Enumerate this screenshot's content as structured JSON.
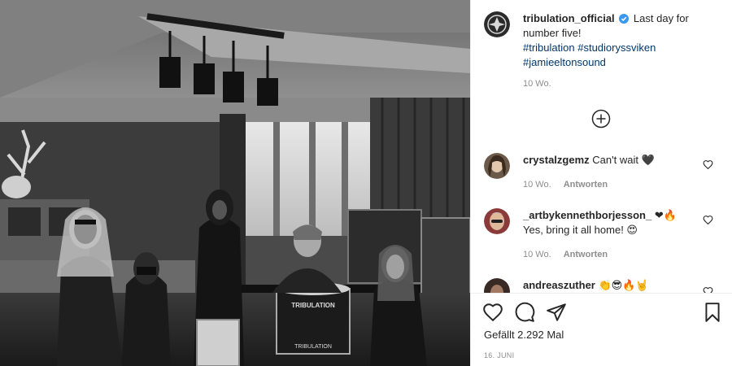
{
  "post": {
    "username": "tribulation_official",
    "caption_text": "Last day for number five!",
    "hashtags": [
      "#tribulation",
      "#studioryssviken",
      "#jamieeltonsound"
    ],
    "caption_time": "10 Wo.",
    "photo_text": {
      "drum_top": "TRIBULATION",
      "drum_bottom": "TRIBULATION"
    }
  },
  "comments": [
    {
      "username": "crystalzgemz",
      "text": "Can't wait 🖤",
      "time": "10 Wo.",
      "reply": "Antworten"
    },
    {
      "username": "_artbykennethborjesson_",
      "text_line1": "❤🔥",
      "text_line2": "Yes, bring it all home! 😍",
      "time": "10 Wo.",
      "reply": "Antworten"
    },
    {
      "username": "andreaszuther",
      "text": "👏😎🔥🤘"
    }
  ],
  "footer": {
    "likes": "Gefällt 2.292 Mal",
    "date": "16. JUNI"
  },
  "icons": [
    "verified-badge-icon",
    "plus-circle-icon",
    "heart-icon",
    "comment-icon",
    "share-icon",
    "bookmark-icon"
  ]
}
